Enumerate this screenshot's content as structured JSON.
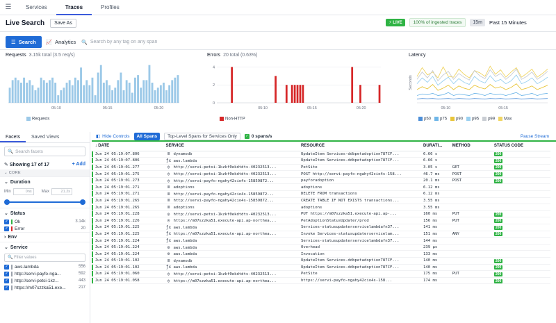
{
  "nav": {
    "tabs": [
      {
        "label": "Services"
      },
      {
        "label": "Traces"
      },
      {
        "label": "Profiles"
      }
    ]
  },
  "header": {
    "title": "Live Search",
    "save_as": "Save As",
    "live_badge": "LIVE",
    "ingested": "100% of ingested traces",
    "time_abbr": "15m",
    "time_range": "Past 15 Minutes"
  },
  "search": {
    "search_button": "Search",
    "analytics_button": "Analytics",
    "placeholder": "Search by any tag on any span"
  },
  "charts": {
    "requests": {
      "title": "Requests",
      "subtitle": "3.15k total (3.5 req/s)",
      "legend": "Requests",
      "color": "#9cc9e8"
    },
    "errors": {
      "title": "Errors",
      "subtitle": "20 total (0.63%)",
      "legend": "Non-HTTP",
      "color": "#d62728"
    },
    "latency": {
      "title": "Latency",
      "ylabel": "Seconds",
      "legend": [
        "p50",
        "p75",
        "p90",
        "p95",
        "p99",
        "Max"
      ]
    }
  },
  "chart_data": [
    {
      "type": "bar",
      "title": "Requests",
      "subtitle": "3.15k total (3.5 req/s)",
      "x_ticks": [
        "05:10",
        "05:15",
        "05:20"
      ],
      "y_ticks": [],
      "series": [
        {
          "name": "Requests",
          "values": [
            6,
            9,
            10,
            9,
            8,
            10,
            8,
            9,
            7,
            5,
            6,
            10,
            9,
            8,
            9,
            10,
            8,
            3,
            5,
            6,
            8,
            9,
            7,
            10,
            9,
            14,
            7,
            9,
            7,
            10,
            3,
            12,
            15,
            8,
            9,
            7,
            5,
            6,
            9,
            12,
            5,
            9,
            8,
            4,
            10,
            11,
            6,
            9,
            9,
            15,
            8,
            5,
            6,
            7,
            8,
            5,
            7,
            9,
            10,
            11
          ]
        }
      ],
      "ylim": [
        0,
        16
      ]
    },
    {
      "type": "bar",
      "title": "Errors",
      "subtitle": "20 total (0.63%)",
      "x_ticks": [
        "05:10",
        "05:15",
        "05:20"
      ],
      "y_ticks": [
        0,
        2,
        4
      ],
      "series": [
        {
          "name": "Non-HTTP",
          "values": [
            0,
            0,
            0,
            0,
            0,
            4,
            0,
            0,
            0,
            0,
            0,
            0,
            0,
            0,
            0,
            0,
            0,
            0,
            0,
            0,
            0,
            3,
            0,
            0,
            0,
            2,
            0,
            2,
            2,
            2,
            2,
            2,
            0,
            0,
            0,
            0,
            0,
            0,
            0,
            0,
            0,
            0,
            0,
            0,
            0,
            0,
            0,
            0,
            0,
            4,
            0,
            0,
            2,
            0,
            0,
            0,
            0,
            0,
            0,
            2
          ]
        }
      ],
      "ylim": [
        0,
        4.5
      ]
    },
    {
      "type": "line",
      "title": "Latency",
      "ylabel": "Seconds",
      "x_ticks": [
        "05:10",
        "05:15"
      ],
      "series": [
        {
          "name": "p50",
          "color": "#4c8ed8",
          "values": [
            0.5,
            0.6,
            0.55,
            0.6,
            0.5,
            0.55,
            0.6,
            0.5,
            0.6,
            0.55,
            0.5,
            0.6,
            0.55,
            0.5,
            0.6,
            0.55,
            0.6,
            0.5,
            0.55,
            0.6,
            0.5,
            0.55,
            0.6,
            0.5,
            0.55,
            0.6
          ]
        },
        {
          "name": "p75",
          "color": "#6fb6e8",
          "values": [
            1.0,
            1.2,
            1.1,
            1.3,
            1.0,
            1.1,
            1.4,
            1.0,
            1.2,
            1.1,
            1.0,
            1.3,
            1.2,
            1.0,
            1.3,
            1.1,
            1.2,
            1.0,
            1.2,
            1.4,
            1.0,
            1.1,
            1.3,
            1.0,
            1.2,
            1.3
          ]
        },
        {
          "name": "p90",
          "color": "#e8c53a",
          "values": [
            1.8,
            2.2,
            1.9,
            2.5,
            1.7,
            2.0,
            2.4,
            1.8,
            2.3,
            2.0,
            1.8,
            2.4,
            2.1,
            1.9,
            2.5,
            2.0,
            2.2,
            1.8,
            2.1,
            2.6,
            1.8,
            2.0,
            2.3,
            1.8,
            2.1,
            2.4
          ]
        },
        {
          "name": "p95",
          "color": "#9ad0f0",
          "values": [
            2.6,
            3.4,
            2.8,
            3.6,
            2.4,
            3.0,
            3.5,
            2.6,
            3.3,
            2.8,
            2.5,
            3.6,
            3.0,
            2.7,
            3.7,
            2.9,
            3.2,
            2.6,
            3.0,
            3.8,
            2.6,
            2.9,
            3.4,
            2.6,
            3.0,
            3.5
          ]
        },
        {
          "name": "p99",
          "color": "#c9cdd3",
          "values": [
            3.2,
            4.2,
            3.4,
            4.4,
            3.0,
            3.8,
            4.3,
            3.2,
            4.0,
            3.5,
            3.1,
            4.4,
            3.7,
            3.3,
            4.5,
            3.6,
            4.0,
            3.2,
            3.8,
            4.6,
            3.2,
            3.6,
            4.2,
            3.2,
            3.7,
            4.3
          ]
        },
        {
          "name": "Max",
          "color": "#f0d564",
          "values": [
            3.6,
            4.8,
            3.8,
            4.2,
            3.4,
            4.9,
            3.6,
            3.5,
            4.6,
            3.9,
            3.4,
            4.4,
            4.1,
            3.6,
            5.0,
            3.9,
            4.5,
            3.5,
            4.2,
            4.8,
            3.5,
            4.0,
            4.6,
            3.5,
            4.0,
            4.6
          ]
        }
      ],
      "ylim": [
        0,
        5.5
      ]
    }
  ],
  "facets": {
    "tabs": [
      "Facets",
      "Saved Views"
    ],
    "search_placeholder": "Search facets",
    "showing": "Showing 17 of 17",
    "add": "+ Add",
    "core": "CORE",
    "duration": {
      "title": "Duration",
      "min_label": "Min",
      "min_value": "0ns",
      "max_label": "Max",
      "max_value": "21.2s",
      "slider_min": 0,
      "slider_max": 1
    },
    "status": {
      "title": "Status",
      "items": [
        {
          "label": "Ok",
          "count": "3.14k",
          "color": "#2fb344"
        },
        {
          "label": "Error",
          "count": "20",
          "color": "#d62728"
        }
      ]
    },
    "env": {
      "title": "Env"
    },
    "service": {
      "title": "Service",
      "filter_placeholder": "Filter values",
      "items": [
        {
          "label": "aws.lambda",
          "count": "556"
        },
        {
          "label": "http://servi-payfo-nga...",
          "count": "592"
        },
        {
          "label": "http://servi-petsi-1kz...",
          "count": "443"
        },
        {
          "label": "https://m07szzka51.exe...",
          "count": "217"
        }
      ]
    }
  },
  "table": {
    "hide_controls": "Hide Controls",
    "all_spans": "All Spans",
    "top_level": "Top-Level Spans for Services Only",
    "spans_rate": "0 spans/s",
    "pause": "Pause Stream",
    "columns": [
      "DATE",
      "SERVICE",
      "RESOURCE",
      "DURATI...",
      "METHOD",
      "STATUS CODE"
    ],
    "rows": [
      {
        "date": "Jun 24 05:19:07.806",
        "icon": "database",
        "service": "dynamodb",
        "resource": "UpdateItem Services-ddbpetadoption787CF...",
        "duration": "6.66 s",
        "method": "",
        "status": "200"
      },
      {
        "date": "Jun 24 05:19:07.806",
        "icon": "lambda",
        "service": "aws.lambda",
        "resource": "UpdateItem Services-ddbpetadoption787CF...",
        "duration": "6.66 s",
        "method": "",
        "status": "200"
      },
      {
        "date": "Jun 24 05:19:01.277",
        "icon": "globe",
        "service": "http://servi-petsi-1kzkf0ekdtdts-40232513...",
        "resource": "PetSite",
        "duration": "3.05 s",
        "method": "GET",
        "status": "200"
      },
      {
        "date": "Jun 24 05:19:01.275",
        "icon": "globe",
        "service": "http://servi-petsi-1kzkf0ekdtdts-40232513...",
        "resource": "POST http://servi-payfo-ngahy42cio4s-158...",
        "duration": "46.7 ms",
        "method": "POST",
        "status": "200"
      },
      {
        "date": "Jun 24 05:19:01.273",
        "icon": "globe",
        "service": "http://servi-payfo-ngahy42cio4s-15859872...",
        "resource": "payforadoption",
        "duration": "20.1 ms",
        "method": "POST",
        "status": "200"
      },
      {
        "date": "Jun 24 05:19:01.271",
        "icon": "database",
        "service": "adoptions",
        "resource": "adoptions",
        "duration": "6.12 ms",
        "method": "",
        "status": ""
      },
      {
        "date": "Jun 24 05:19:01.271",
        "icon": "database",
        "service": "http://servi-payfo-ngahy42cio4s-15859872...",
        "resource": "DELETE FROM transactions",
        "duration": "6.12 ms",
        "method": "",
        "status": ""
      },
      {
        "date": "Jun 24 05:19:01.265",
        "icon": "database",
        "service": "http://servi-payfo-ngahy42cio4s-15859872...",
        "resource": "CREATE TABLE IF NOT EXISTS transactions...",
        "duration": "3.55 ms",
        "method": "",
        "status": ""
      },
      {
        "date": "Jun 24 05:19:01.265",
        "icon": "database",
        "service": "adoptions",
        "resource": "adoptions",
        "duration": "3.55 ms",
        "method": "",
        "status": ""
      },
      {
        "date": "Jun 24 05:19:01.228",
        "icon": "globe",
        "service": "http://servi-petsi-1kzkf0ekdtdts-40232513...",
        "resource": "PUT https://m07szzka51.execute-api.ap-...",
        "duration": "160 ms",
        "method": "PUT",
        "status": "200"
      },
      {
        "date": "Jun 24 05:19:01.226",
        "icon": "globe",
        "service": "https://m07szzka51.execute-api.ap-northea...",
        "resource": "PetAdoptionStatusUpdater/prod",
        "duration": "156 ms",
        "method": "PUT",
        "status": "200"
      },
      {
        "date": "Jun 24 05:19:01.225",
        "icon": "lambda",
        "service": "aws.lambda",
        "resource": "Services-statusupdaterservicelambdafn37...",
        "duration": "141 ms",
        "method": "",
        "status": "200"
      },
      {
        "date": "Jun 24 05:19:01.225",
        "icon": "lambda",
        "service": "https://m07szzka51.execute-api.ap-northea...",
        "resource": "Invoke Services-statusupdaterservicelam...",
        "duration": "151 ms",
        "method": "ANY",
        "status": "200"
      },
      {
        "date": "Jun 24 05:19:01.224",
        "icon": "lambda",
        "service": "aws.lambda",
        "resource": "Services-statusupdaterservicelambdafn37...",
        "duration": "144 ms",
        "method": "",
        "status": ""
      },
      {
        "date": "Jun 24 05:19:01.224",
        "icon": "gears",
        "service": "aws.lambda",
        "resource": "Overhead",
        "duration": "239 µs",
        "method": "",
        "status": ""
      },
      {
        "date": "Jun 24 05:19:01.224",
        "icon": "gears",
        "service": "aws.lambda",
        "resource": "Invocation",
        "duration": "133 ms",
        "method": "",
        "status": ""
      },
      {
        "date": "Jun 24 05:19:01.102",
        "icon": "database",
        "service": "dynamodb",
        "resource": "UpdateItem Services-ddbpetadoption787CF...",
        "duration": "140 ms",
        "method": "",
        "status": "200"
      },
      {
        "date": "Jun 24 05:19:01.102",
        "icon": "lambda",
        "service": "aws.lambda",
        "resource": "UpdateItem Services-ddbpetadoption787CF...",
        "duration": "140 ms",
        "method": "",
        "status": "200"
      },
      {
        "date": "Jun 24 05:19:01.060",
        "icon": "globe",
        "service": "http://servi-petsi-1kzkf0ekdtdts-40232513...",
        "resource": "PetSite",
        "duration": "175 ms",
        "method": "PUT",
        "status": "200"
      },
      {
        "date": "Jun 24 05:19:01.058",
        "icon": "globe",
        "service": "https://m07szzka51.execute-api.ap-northea...",
        "resource": "https://servi-payfo-ngahy42cio4s-158...",
        "duration": "174 ms",
        "method": "",
        "status": "200"
      }
    ]
  }
}
